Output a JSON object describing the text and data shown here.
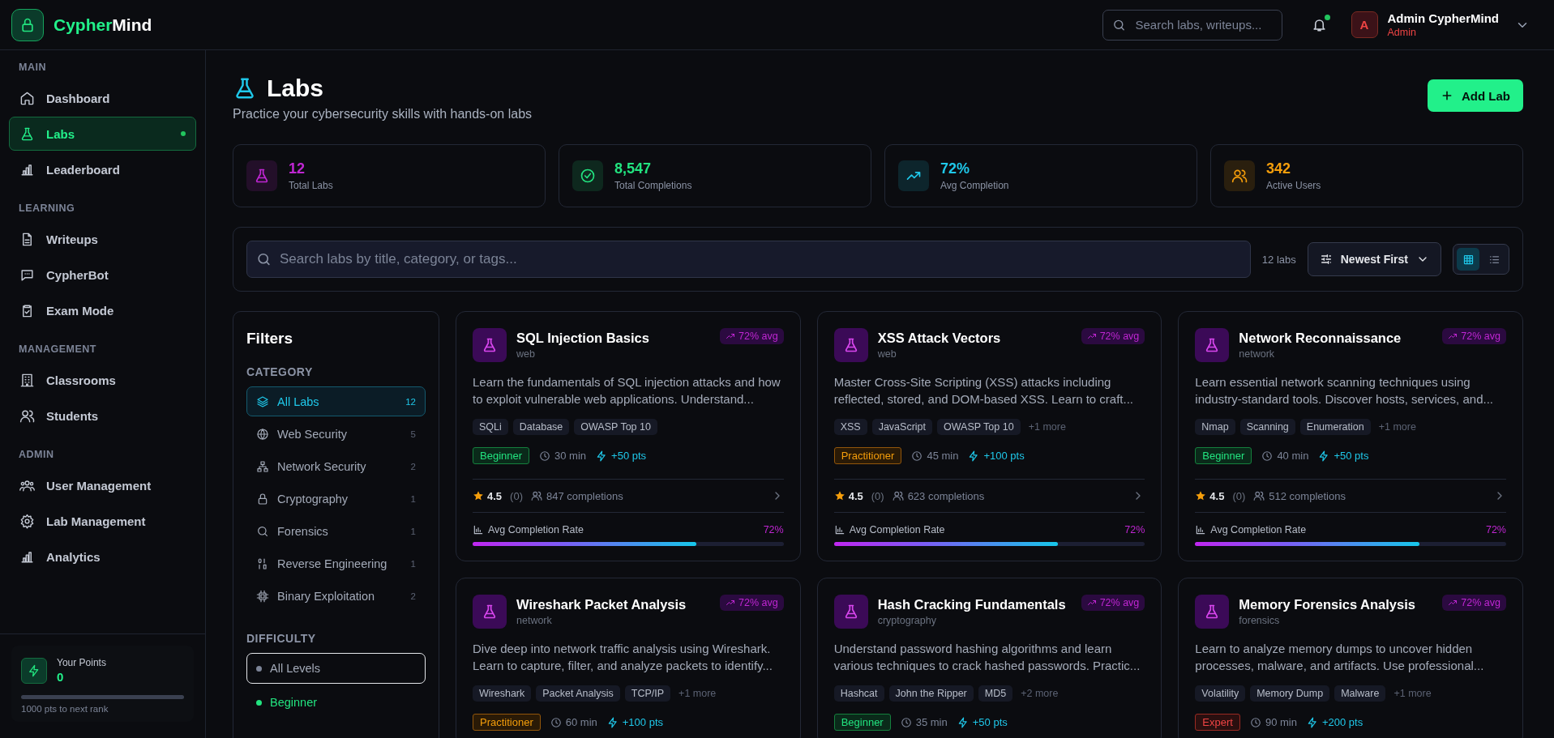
{
  "brand": {
    "first": "Cypher",
    "second": "Mind"
  },
  "header": {
    "search": {
      "placeholder": "Search labs, writeups..."
    },
    "notifications": {
      "unread": true
    },
    "user": {
      "initial": "A",
      "name": "Admin CypherMind",
      "role": "Admin"
    }
  },
  "sidebar": {
    "sections": [
      {
        "label": "MAIN",
        "items": [
          {
            "label": "Dashboard",
            "kind": "home",
            "selected": false
          },
          {
            "label": "Labs",
            "kind": "flask",
            "selected": true
          },
          {
            "label": "Leaderboard",
            "kind": "bars",
            "selected": false
          }
        ]
      },
      {
        "label": "LEARNING",
        "items": [
          {
            "label": "Writeups",
            "kind": "doc",
            "selected": false
          },
          {
            "label": "CypherBot",
            "kind": "chat",
            "selected": false
          },
          {
            "label": "Exam Mode",
            "kind": "clipboard",
            "selected": false
          }
        ]
      },
      {
        "label": "MANAGEMENT",
        "items": [
          {
            "label": "Classrooms",
            "kind": "building",
            "selected": false
          },
          {
            "label": "Students",
            "kind": "users",
            "selected": false
          }
        ]
      },
      {
        "label": "ADMIN",
        "items": [
          {
            "label": "User Management",
            "kind": "group",
            "selected": false
          },
          {
            "label": "Lab Management",
            "kind": "gear",
            "selected": false
          },
          {
            "label": "Analytics",
            "kind": "bars",
            "selected": false
          }
        ]
      }
    ],
    "points": {
      "label": "Your Points",
      "value": "0",
      "level": 0,
      "caption": "1000 pts to next rank"
    }
  },
  "page": {
    "title": "Labs",
    "subtitle": "Practice your cybersecurity skills with hands-on labs",
    "add_button": "Add Lab"
  },
  "stats": [
    {
      "value": "12",
      "label": "Total Labs",
      "kind": "flask",
      "color": "#c026d3"
    },
    {
      "value": "8,547",
      "label": "Total Completions",
      "kind": "check",
      "color": "#22e37f"
    },
    {
      "value": "72%",
      "label": "Avg Completion",
      "kind": "trend",
      "color": "#1fc8ea"
    },
    {
      "value": "342",
      "label": "Active Users",
      "kind": "users",
      "color": "#f59e0b"
    }
  ],
  "toolbar": {
    "search": {
      "placeholder": "Search labs by title, category, or tags..."
    },
    "count": "12 labs",
    "sort": "Newest First",
    "views": [
      {
        "kind": "grid",
        "selected": true
      },
      {
        "kind": "list",
        "selected": false
      }
    ]
  },
  "filters": {
    "title": "Filters",
    "category_label": "CATEGORY",
    "categories": [
      {
        "label": "All Labs",
        "count": "12",
        "kind": "layers",
        "selected": true
      },
      {
        "label": "Web Security",
        "count": "5",
        "kind": "globe",
        "selected": false
      },
      {
        "label": "Network Security",
        "count": "2",
        "kind": "network",
        "selected": false
      },
      {
        "label": "Cryptography",
        "count": "1",
        "kind": "lock",
        "selected": false
      },
      {
        "label": "Forensics",
        "count": "1",
        "kind": "search",
        "selected": false
      },
      {
        "label": "Reverse Engineering",
        "count": "1",
        "kind": "binary",
        "selected": false
      },
      {
        "label": "Binary Exploitation",
        "count": "2",
        "kind": "chip",
        "selected": false
      }
    ],
    "difficulty_label": "DIFFICULTY",
    "difficulties": [
      {
        "label": "All Levels",
        "kind": "all",
        "selected": true
      },
      {
        "label": "Beginner",
        "kind": "beginner",
        "selected": false
      }
    ]
  },
  "labs": [
    {
      "title": "SQL Injection Basics",
      "category": "web",
      "badge": "72% avg",
      "description": "Learn the fundamentals of SQL injection attacks and how to exploit vulnerable web applications. Understand...",
      "tags": [
        "SQLi",
        "Database",
        "OWASP Top 10"
      ],
      "difficulty": {
        "label": "Beginner",
        "kind": "beginner"
      },
      "duration": "30 min",
      "points": "+50 pts",
      "rating": "4.5",
      "reviews": "(0)",
      "completions": "847 completions",
      "rate_label": "Avg Completion Rate",
      "rate_text": "72%",
      "level": 0.72
    },
    {
      "title": "XSS Attack Vectors",
      "category": "web",
      "badge": "72% avg",
      "description": "Master Cross-Site Scripting (XSS) attacks including reflected, stored, and DOM-based XSS. Learn to craft...",
      "tags": [
        "XSS",
        "JavaScript",
        "OWASP Top 10"
      ],
      "more": "+1 more",
      "difficulty": {
        "label": "Practitioner",
        "kind": "practitioner"
      },
      "duration": "45 min",
      "points": "+100 pts",
      "rating": "4.5",
      "reviews": "(0)",
      "completions": "623 completions",
      "rate_label": "Avg Completion Rate",
      "rate_text": "72%",
      "level": 0.72
    },
    {
      "title": "Network Reconnaissance",
      "category": "network",
      "badge": "72% avg",
      "description": "Learn essential network scanning techniques using industry-standard tools. Discover hosts, services, and...",
      "tags": [
        "Nmap",
        "Scanning",
        "Enumeration"
      ],
      "more": "+1 more",
      "difficulty": {
        "label": "Beginner",
        "kind": "beginner"
      },
      "duration": "40 min",
      "points": "+50 pts",
      "rating": "4.5",
      "reviews": "(0)",
      "completions": "512 completions",
      "rate_label": "Avg Completion Rate",
      "rate_text": "72%",
      "level": 0.72
    },
    {
      "title": "Wireshark Packet Analysis",
      "category": "network",
      "badge": "72% avg",
      "description": "Dive deep into network traffic analysis using Wireshark. Learn to capture, filter, and analyze packets to identify...",
      "tags": [
        "Wireshark",
        "Packet Analysis",
        "TCP/IP"
      ],
      "more": "+1 more",
      "difficulty": {
        "label": "Practitioner",
        "kind": "practitioner"
      },
      "duration": "60 min",
      "points": "+100 pts"
    },
    {
      "title": "Hash Cracking Fundamentals",
      "category": "cryptography",
      "badge": "72% avg",
      "description": "Understand password hashing algorithms and learn various techniques to crack hashed passwords. Practic...",
      "tags": [
        "Hashcat",
        "John the Ripper",
        "MD5"
      ],
      "more": "+2 more",
      "difficulty": {
        "label": "Beginner",
        "kind": "beginner"
      },
      "duration": "35 min",
      "points": "+50 pts"
    },
    {
      "title": "Memory Forensics Analysis",
      "category": "forensics",
      "badge": "72% avg",
      "description": "Learn to analyze memory dumps to uncover hidden processes, malware, and artifacts. Use professional...",
      "tags": [
        "Volatility",
        "Memory Dump",
        "Malware"
      ],
      "more": "+1 more",
      "difficulty": {
        "label": "Expert",
        "kind": "expert"
      },
      "duration": "90 min",
      "points": "+200 pts"
    }
  ]
}
